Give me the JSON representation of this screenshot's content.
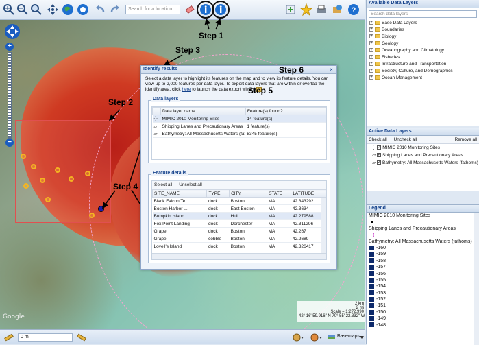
{
  "toolbar": {
    "search_placeholder": "Search for a location",
    "icons": [
      "zoom-in-icon",
      "zoom-out-icon",
      "zoom-box-icon",
      "pan-icon",
      "full-extent-icon",
      "globe-icon",
      "undo-icon",
      "redo-icon",
      "erase-icon",
      "identify-icon",
      "identify-point-icon",
      "add-layer-icon",
      "bookmark-icon",
      "print-icon",
      "share-icon",
      "help-icon"
    ]
  },
  "annotations": {
    "step1": "Step 1",
    "step2": "Step 2",
    "step3": "Step 3",
    "step4": "Step 4",
    "step5": "Step 5",
    "step6": "Step 6"
  },
  "map": {
    "watermark": "Google",
    "scale_km": "2 km",
    "scale_mi": "2 mi",
    "scale_ratio": "Scale = 1:272,990",
    "coords": "42° 16' 59.916\" N 70° 55' 22.332\" W"
  },
  "dialog": {
    "title": "Identify results",
    "close": "×",
    "desc_part1": "Select a data layer to highlight its features on the map and to view its feature details. You can view up to 2,000 features per data layer. To export data layers that are within or overlap the identify area, click ",
    "desc_link": "here",
    "desc_part2": " to launch the data export wizard",
    "data_layers_label": "Data layers",
    "layer_cols": [
      "Data layer name",
      "Feature(s) found?"
    ],
    "layers": [
      {
        "name": "MIMIC 2010 Monitoring Sites",
        "found": "14 feature(s)"
      },
      {
        "name": "Shipping Lanes and Precautionary Areas",
        "found": "1 feature(s)"
      },
      {
        "name": "Bathymetry: All Massachusetts Waters (fat...",
        "found": "8345 feature(s)"
      }
    ],
    "feature_details_label": "Feature details",
    "select_all": "Select all",
    "unselect_all": "Unselect all",
    "feature_cols": [
      "SITE_NAME",
      "TYPE",
      "CITY",
      "STATE",
      "LATITUDE"
    ],
    "features": [
      [
        "Black Falcon Te...",
        "dock",
        "Boston",
        "MA",
        "42.343292"
      ],
      [
        "Boston Harbor ...",
        "dock",
        "East Boston",
        "MA",
        "42.3634"
      ],
      [
        "Bumpkin Island",
        "dock",
        "Hull",
        "MA",
        "42.279588"
      ],
      [
        "Fox Point Landing",
        "dock",
        "Dorchester",
        "MA",
        "42.311296"
      ],
      [
        "Grape",
        "dock",
        "Boston",
        "MA",
        "42.267"
      ],
      [
        "Grape",
        "cobble",
        "Boston",
        "MA",
        "42.2689"
      ],
      [
        "Lovell's Island",
        "dock",
        "Boston",
        "MA",
        "42.326417"
      ]
    ]
  },
  "available_layers": {
    "title": "Available Data Layers",
    "search_placeholder": "Search data layers",
    "items": [
      "Base Data Layers",
      "Boundaries",
      "Biology",
      "Geology",
      "Oceanography and Climatology",
      "Fisheries",
      "Infrastructure and Transportation",
      "Society, Culture, and Demographics",
      "Ocean Management"
    ]
  },
  "active_layers": {
    "title": "Active Data Layers",
    "check_all": "Check all",
    "uncheck_all": "Uncheck all",
    "remove_all": "Remove all",
    "items": [
      "MIMIC 2010 Monitoring Sites",
      "Shipping Lanes and Precautionary Areas",
      "Bathymetry: All Massachusetts Waters (fathoms)"
    ]
  },
  "legend": {
    "title": "Legend",
    "layer1": "MIMIC 2010 Monitoring Sites",
    "layer2": "Shipping Lanes and Precautionary Areas",
    "layer3": "Bathymetry: All Massachusetts Waters (fathoms)",
    "depths": [
      "-160",
      "-159",
      "-158",
      "-157",
      "-156",
      "-155",
      "-154",
      "-153",
      "-152",
      "-151",
      "-150",
      "-149",
      "-148"
    ],
    "swatch_color": "#0d2a6b"
  },
  "bottom": {
    "measure_value": "0 m",
    "basemaps": "Basemaps"
  }
}
